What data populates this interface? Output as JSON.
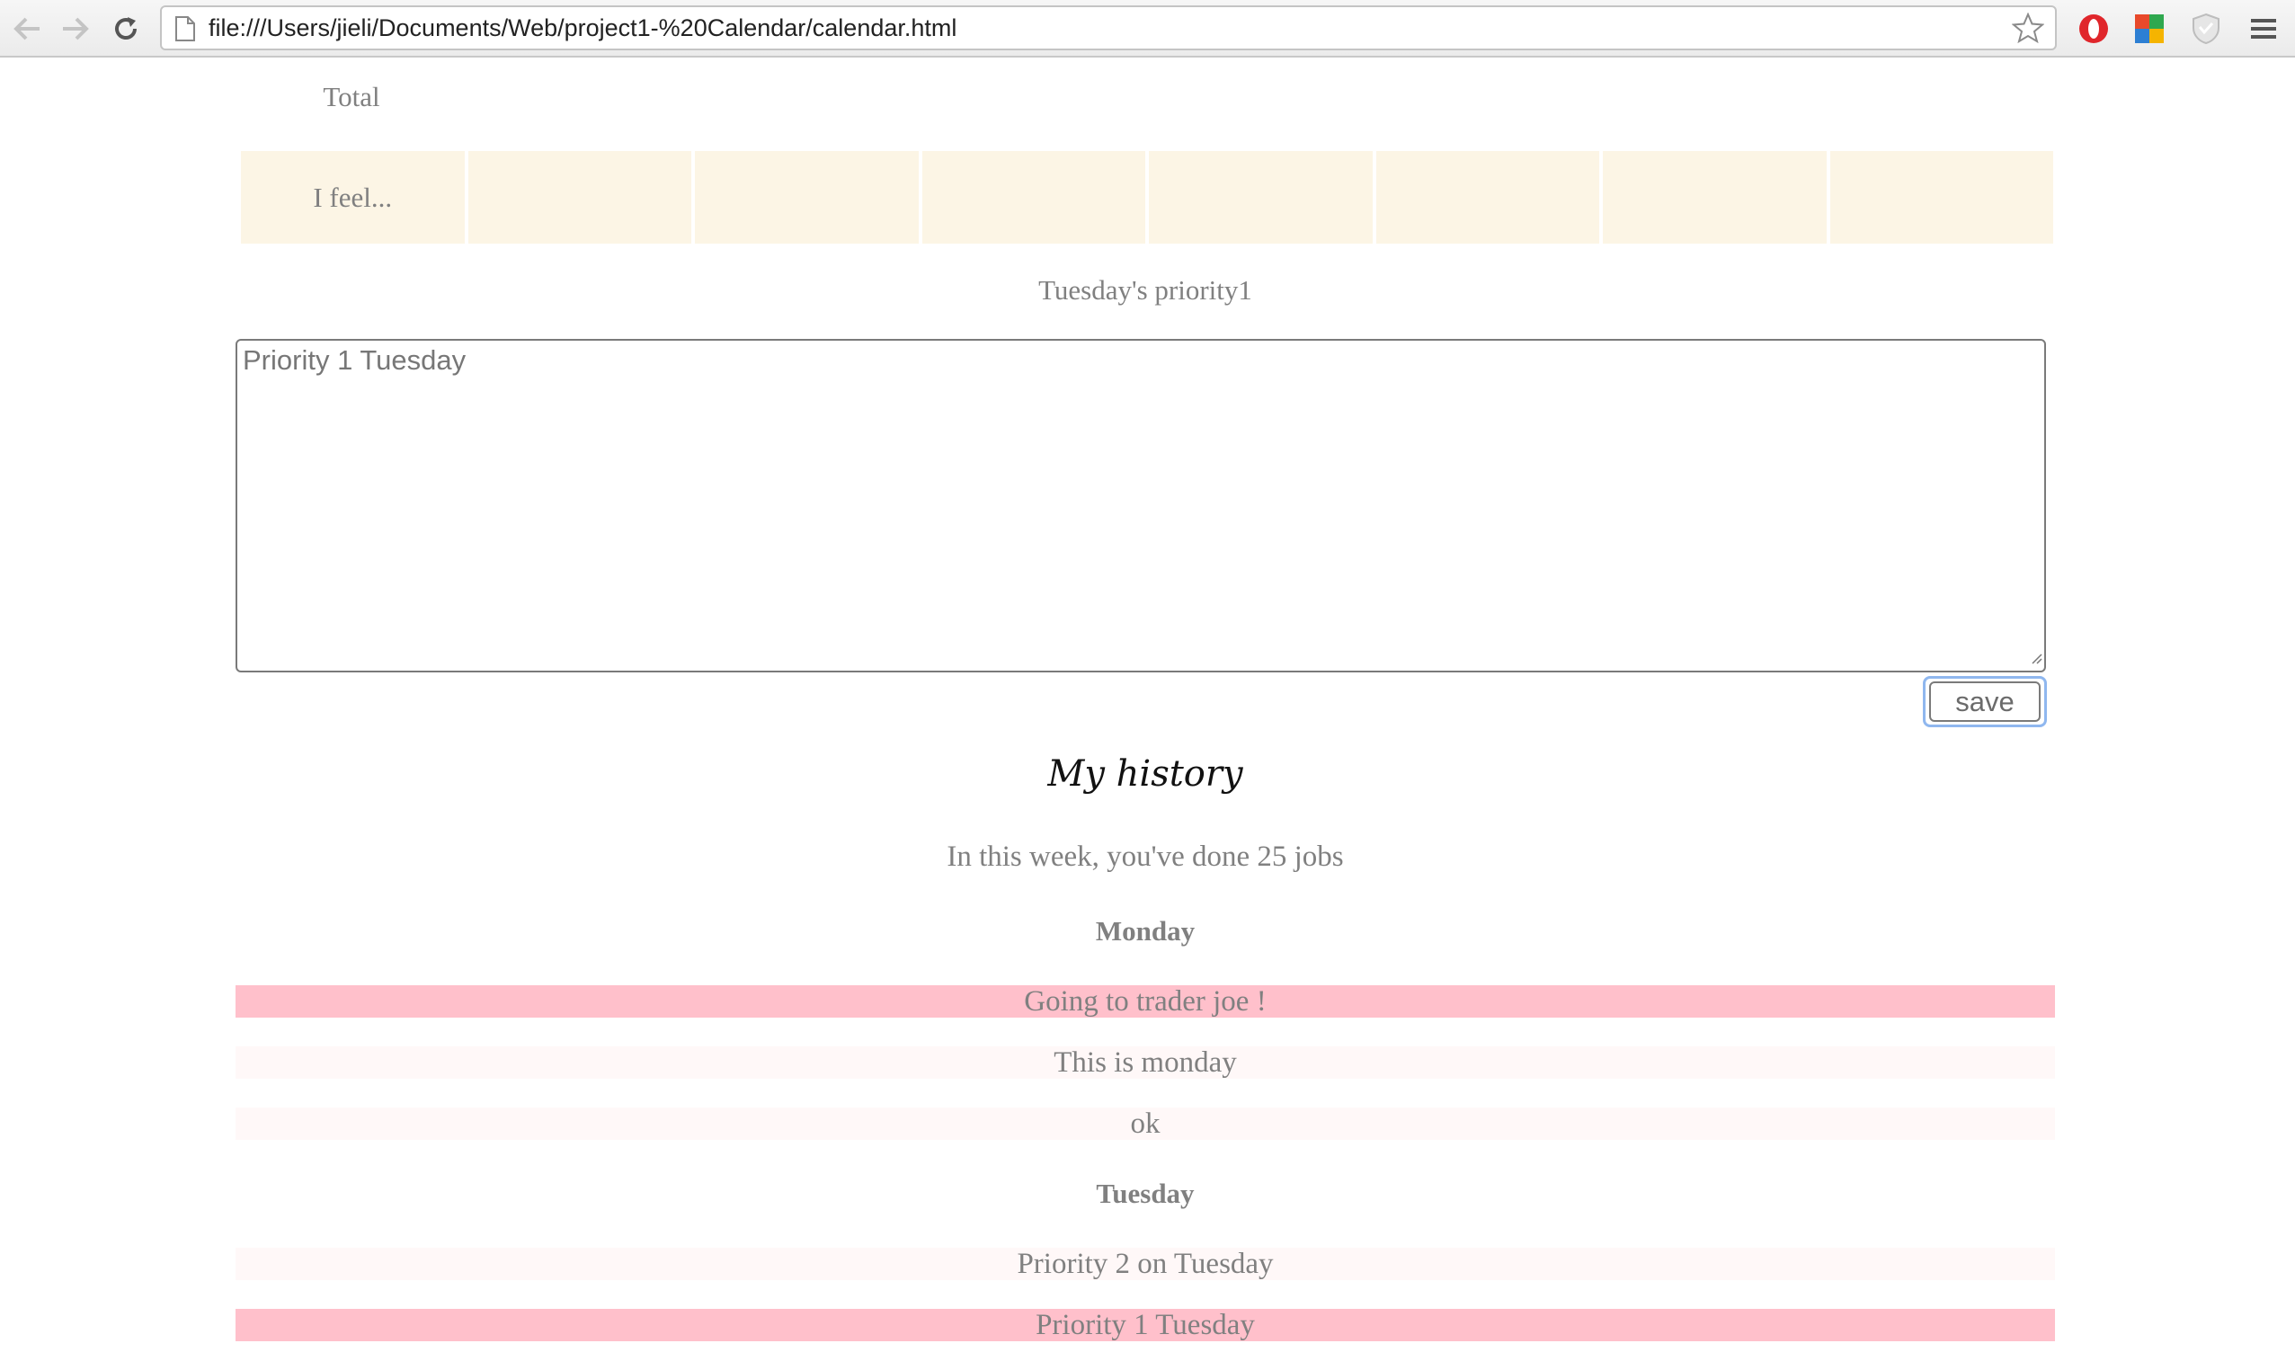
{
  "browser": {
    "url": "file:///Users/jieli/Documents/Web/project1-%20Calendar/calendar.html",
    "icons": [
      "back-arrow-icon",
      "forward-arrow-icon",
      "reload-icon",
      "page-icon",
      "bookmark-star-icon",
      "opera-extension-icon",
      "colorful-extension-icon",
      "shield-extension-icon",
      "menu-icon"
    ]
  },
  "table": {
    "total_label": "Total",
    "feel_label": "I feel...",
    "feel_cells": [
      "",
      "",
      "",
      "",
      "",
      "",
      ""
    ],
    "feel_cell_color": "#fcf5e5"
  },
  "editor": {
    "heading": "Tuesday's priority1",
    "text": "Priority 1 Tuesday",
    "save_label": "save"
  },
  "history": {
    "title": "My history",
    "summary": "In this week, you've done 25 jobs",
    "days": [
      {
        "day": "Monday",
        "items": [
          {
            "text": "Going to trader joe !",
            "highlight": "#ffc0cb"
          },
          {
            "text": "This is monday",
            "highlight": "#fff8f8"
          },
          {
            "text": "ok",
            "highlight": "#fff8f8"
          }
        ]
      },
      {
        "day": "Tuesday",
        "items": [
          {
            "text": "Priority 2 on Tuesday",
            "highlight": "#fff8f8"
          },
          {
            "text": "Priority 1 Tuesday",
            "highlight": "#ffc0cb"
          }
        ]
      }
    ]
  }
}
